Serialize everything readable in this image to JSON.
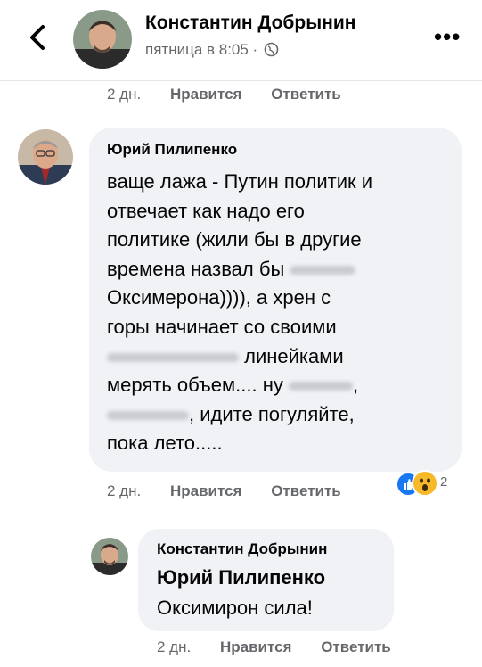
{
  "header": {
    "name": "Константин Добрынин",
    "subtitle": "пятница в 8:05 ·",
    "more_label": "•••"
  },
  "top_actions": {
    "time": "2 дн.",
    "like": "Нравится",
    "reply": "Ответить"
  },
  "comment1": {
    "author": "Юрий Пилипенко",
    "line1": "ваще лажа - Путин политик и",
    "line2": "отвечает как надо его",
    "line3": "политике (жили бы в другие",
    "line4": "времена назвал бы",
    "line5": "Оксимерона)))), а хрен с",
    "line6": "горы начинает со своими",
    "line7": "линейками",
    "line8a": "мерять объем.... ну",
    "line8b": ",",
    "line9": ", идите погуляйте,",
    "line10": "пока лето.....",
    "time": "2 дн.",
    "like": "Нравится",
    "reply": "Ответить",
    "reaction_count": "2"
  },
  "reply": {
    "author": "Константин Добрынин",
    "mention": "Юрий Пилипенко",
    "text": "Оксимирон сила!",
    "time": "2 дн.",
    "like": "Нравится",
    "reply": "Ответить"
  },
  "colors": {
    "link_blue": "#1877f2",
    "bubble": "#f0f2f5",
    "meta_gray": "#65676b"
  }
}
